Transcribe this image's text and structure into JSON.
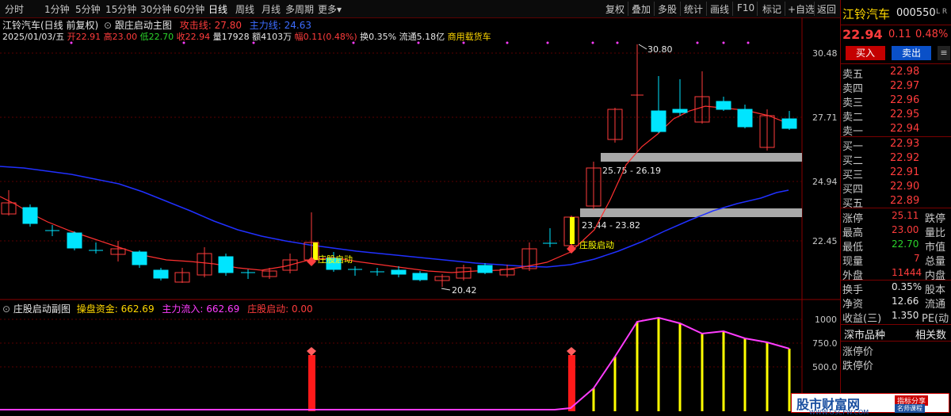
{
  "toolbar": {
    "periods": [
      "分时",
      "1分钟",
      "5分钟",
      "15分钟",
      "30分钟",
      "60分钟",
      "日线",
      "周线",
      "月线",
      "多周期",
      "更多"
    ],
    "active_period": "日线",
    "right_buttons": [
      "复权",
      "叠加",
      "多股",
      "统计",
      "画线",
      "F10",
      "标记",
      "+自选",
      "返回"
    ]
  },
  "main_chart": {
    "title": "江铃汽车(日线 前复权)",
    "indicator_name": "跟庄启动主图",
    "attack_label": "攻击线: 27.80",
    "main_line_label": "主力线: 24.63",
    "date": "2025/01/03/五",
    "open": "开22.91",
    "high": "高23.00",
    "low": "低22.70",
    "close": "收22.94",
    "volume": "量17928",
    "amount": "额4103万",
    "amplitude": "幅0.11(0.48%)",
    "turnover": "换0.35%",
    "float": "流通5.18亿",
    "concept": "商用载货车",
    "axis_ticks": [
      "30.48",
      "27.71",
      "24.94",
      "22.45"
    ],
    "label_high": "30.80",
    "label_low": "20.42",
    "zone_upper": "25.75 - 26.19",
    "zone_lower": "23.44 - 23.82",
    "signal_text_1": "庄股启动",
    "signal_text_2": "庄股启动"
  },
  "sub_chart": {
    "name": "庄股启动副图",
    "fund_label": "操盘资金: 662.69",
    "inflow_label": "主力流入: 662.69",
    "start_label": "庄股启动: 0.00",
    "axis_ticks": [
      "1000",
      "750.0",
      "500.0"
    ]
  },
  "quote": {
    "name": "江铃汽车",
    "code": "000550",
    "tag": "L R",
    "price": "22.94",
    "change": "0.11",
    "change_pct": "0.48%",
    "buy_button": "买入",
    "sell_button": "卖出",
    "ask": [
      {
        "label": "卖五",
        "price": "22.98"
      },
      {
        "label": "卖四",
        "price": "22.97"
      },
      {
        "label": "卖三",
        "price": "22.96"
      },
      {
        "label": "卖二",
        "price": "22.95"
      },
      {
        "label": "卖一",
        "price": "22.94"
      }
    ],
    "bid": [
      {
        "label": "买一",
        "price": "22.93"
      },
      {
        "label": "买二",
        "price": "22.92"
      },
      {
        "label": "买三",
        "price": "22.91"
      },
      {
        "label": "买四",
        "price": "22.90"
      },
      {
        "label": "买五",
        "price": "22.89"
      }
    ],
    "stats": [
      {
        "label": "涨停",
        "value": "25.11",
        "second": "跌停",
        "color": "red"
      },
      {
        "label": "最高",
        "value": "23.00",
        "second": "量比",
        "color": "red"
      },
      {
        "label": "最低",
        "value": "22.70",
        "second": "市值",
        "color": "green"
      },
      {
        "label": "现量",
        "value": "7",
        "second": "总量",
        "color": "red"
      },
      {
        "label": "外盘",
        "value": "11444",
        "second": "内盘",
        "color": "red"
      },
      {
        "label": "换手",
        "value": "0.35%",
        "second": "股本",
        "color": "white"
      },
      {
        "label": "净资",
        "value": "12.66",
        "second": "流通",
        "color": "white"
      },
      {
        "label": "收益(三)",
        "value": "1.350",
        "second": "PE(动",
        "color": "white"
      }
    ],
    "market_tab": "深市品种",
    "related_tab": "相关数",
    "limit_up_price": "涨停价",
    "limit_down_price": "跌停价"
  },
  "watermark": {
    "title": "股市财富网",
    "url": "WWW.GSCFW.COM",
    "tag1": "指标分享",
    "tag2": "名师课程"
  },
  "colors": {
    "up": "#ff3c3c",
    "down": "#00e5ff",
    "ma_red": "#ff3030",
    "ma_blue": "#2030ff",
    "sub_line": "#ff3cff",
    "sub_bar": "#ffff00",
    "zone": "#a8a8a8"
  }
}
